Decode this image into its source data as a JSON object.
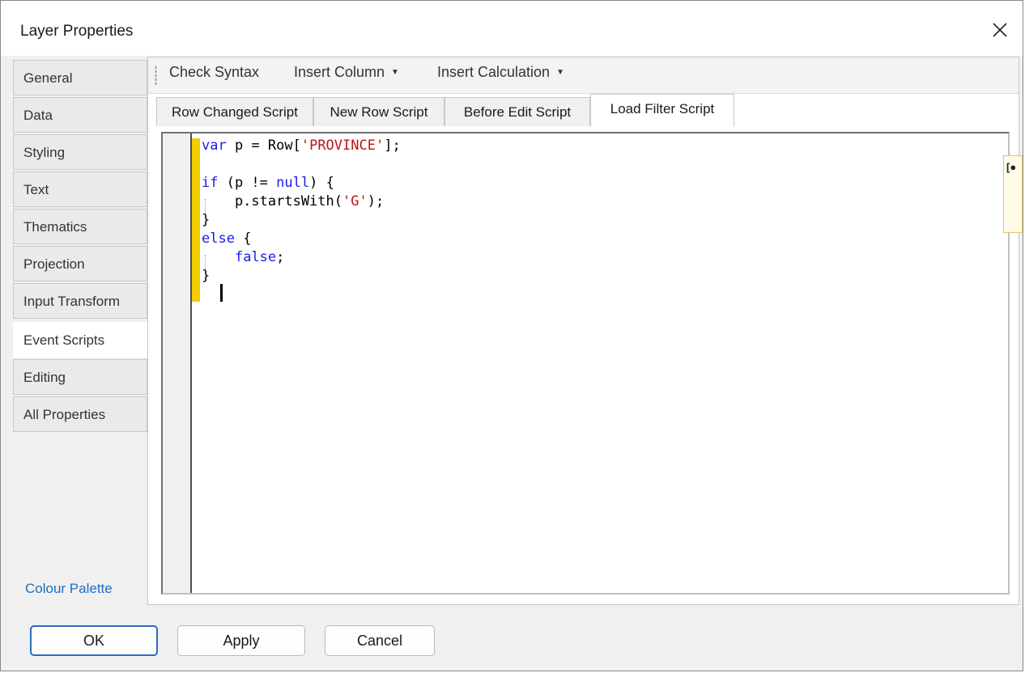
{
  "window": {
    "title": "Layer Properties",
    "close_icon": "close-icon"
  },
  "nav": {
    "items": [
      {
        "label": "General"
      },
      {
        "label": "Data"
      },
      {
        "label": "Styling"
      },
      {
        "label": "Text"
      },
      {
        "label": "Thematics"
      },
      {
        "label": "Projection"
      },
      {
        "label": "Input Transform"
      },
      {
        "label": "Event Scripts",
        "active": true
      },
      {
        "label": "Editing"
      },
      {
        "label": "All Properties"
      }
    ],
    "colour_palette_link": "Colour Palette"
  },
  "toolbar": {
    "check_syntax": "Check Syntax",
    "insert_column": "Insert Column",
    "insert_calculation": "Insert Calculation"
  },
  "tabs": [
    {
      "label": "Row Changed Script"
    },
    {
      "label": "New Row Script"
    },
    {
      "label": "Before Edit Script"
    },
    {
      "label": "Load Filter Script",
      "active": true
    }
  ],
  "editor": {
    "code_lines": [
      "var p = Row['PROVINCE'];",
      "",
      "if (p != null) {",
      "    p.startsWith('G');",
      "}",
      "else {",
      "    false;",
      "}"
    ],
    "side_tip_glyph": "[●"
  },
  "buttons": {
    "ok": "OK",
    "apply": "Apply",
    "cancel": "Cancel"
  },
  "colors": {
    "keyword": "#1a1aee",
    "string": "#b51818",
    "change_bar": "#f2cd00",
    "link": "#1f6fbf",
    "default_button_border": "#2a6cc2"
  }
}
